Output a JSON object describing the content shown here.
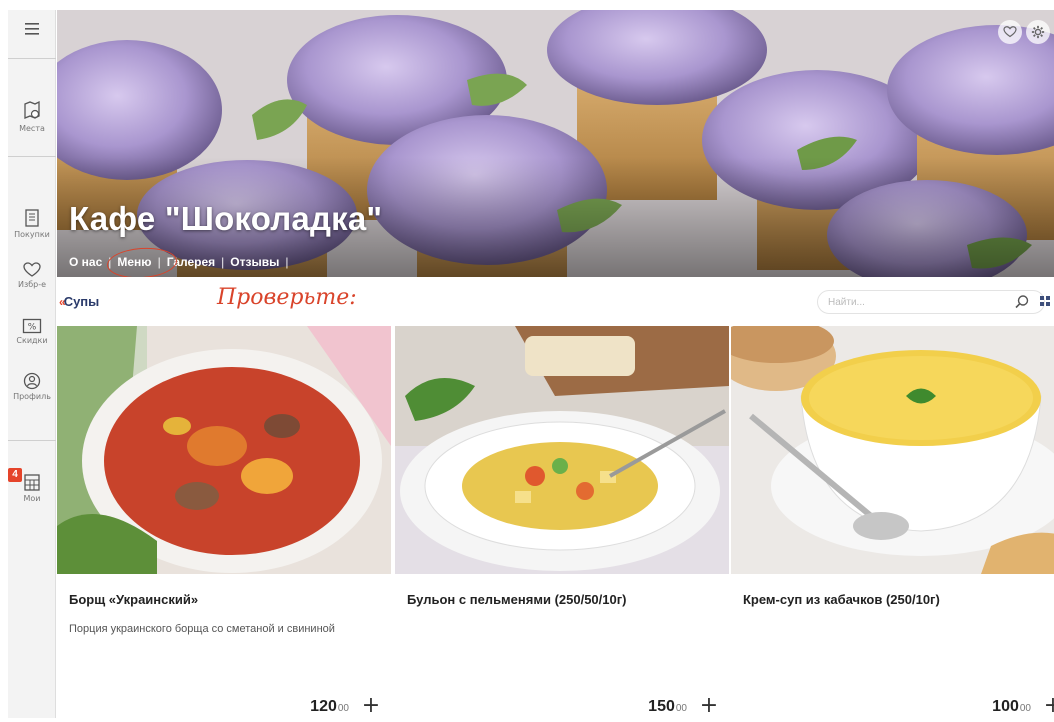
{
  "sidebar": {
    "items": [
      {
        "label": "",
        "icon": "menu-icon"
      },
      {
        "label": "Места",
        "icon": "places-icon"
      },
      {
        "label": "Покупки",
        "icon": "purchases-icon"
      },
      {
        "label": "Избр-е",
        "icon": "heart-icon"
      },
      {
        "label": "Скидки",
        "icon": "discount-icon"
      },
      {
        "label": "Профиль",
        "icon": "profile-icon"
      },
      {
        "label": "Мои",
        "icon": "my-orders-icon",
        "badge": "4"
      }
    ]
  },
  "hero": {
    "title": "Кафе \"Шоколадка\"",
    "nav": [
      "О нас",
      "Меню",
      "Галерея",
      "Отзывы"
    ],
    "active_nav": "Меню"
  },
  "catbar": {
    "back_arrow": "«",
    "category": "Супы",
    "annotation": "Проверьте:",
    "search_placeholder": "Найти..."
  },
  "cards": [
    {
      "title": "Борщ «Украинский»",
      "desc": "Порция украинского борща со сметаной и свининой",
      "price": "120",
      "cents": "00"
    },
    {
      "title": "Бульон с пельменями (250/50/10г)",
      "desc": "",
      "price": "150",
      "cents": "00"
    },
    {
      "title": "Крем-суп из кабачков (250/10г)",
      "desc": "",
      "price": "100",
      "cents": "00"
    }
  ],
  "add_label": "+",
  "colors": {
    "accent": "#e5442a",
    "annotation": "#d9442b",
    "navy": "#2a3a6a"
  }
}
